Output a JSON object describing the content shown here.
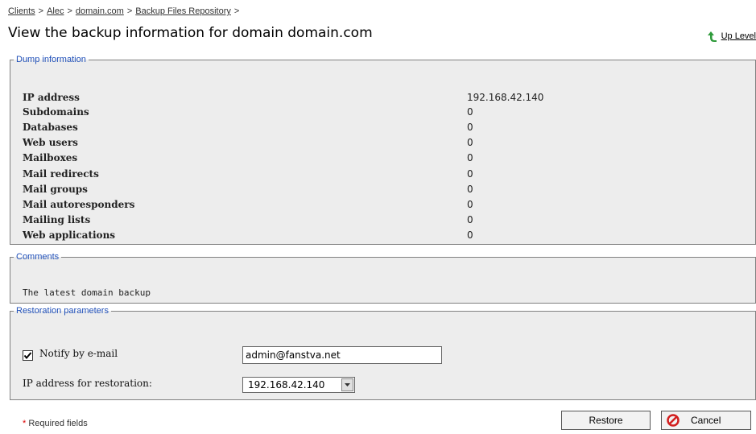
{
  "breadcrumb": [
    {
      "label": "Clients"
    },
    {
      "label": "Alec"
    },
    {
      "label": "domain.com"
    },
    {
      "label": "Backup Files Repository"
    }
  ],
  "breadcrumb_separator": ">",
  "page_title": "View the backup information for domain domain.com",
  "up_level_label": "Up Level",
  "dump": {
    "legend": "Dump information",
    "rows": [
      {
        "label": "IP address",
        "value": "192.168.42.140"
      },
      {
        "label": "Subdomains",
        "value": "0"
      },
      {
        "label": "Databases",
        "value": "0"
      },
      {
        "label": "Web users",
        "value": "0"
      },
      {
        "label": "Mailboxes",
        "value": "0"
      },
      {
        "label": "Mail redirects",
        "value": "0"
      },
      {
        "label": "Mail groups",
        "value": "0"
      },
      {
        "label": "Mail autoresponders",
        "value": "0"
      },
      {
        "label": "Mailing lists",
        "value": "0"
      },
      {
        "label": "Web applications",
        "value": "0"
      }
    ]
  },
  "comments": {
    "legend": "Comments",
    "text": "The latest domain backup"
  },
  "restoration": {
    "legend": "Restoration parameters",
    "notify_label": "Notify by e-mail",
    "notify_checked": true,
    "email_value": "admin@fanstva.net",
    "ip_label": "IP address for restoration:",
    "ip_selected": "192.168.42.140"
  },
  "footer": {
    "required_star": "*",
    "required_text": "Required fields",
    "restore_label": "Restore",
    "cancel_label": "Cancel"
  },
  "colors": {
    "legend_text": "#1f4fb8",
    "panel_bg": "#ededed",
    "up_arrow": "#2e9a3a",
    "cancel_icon": "#d21f1f"
  }
}
